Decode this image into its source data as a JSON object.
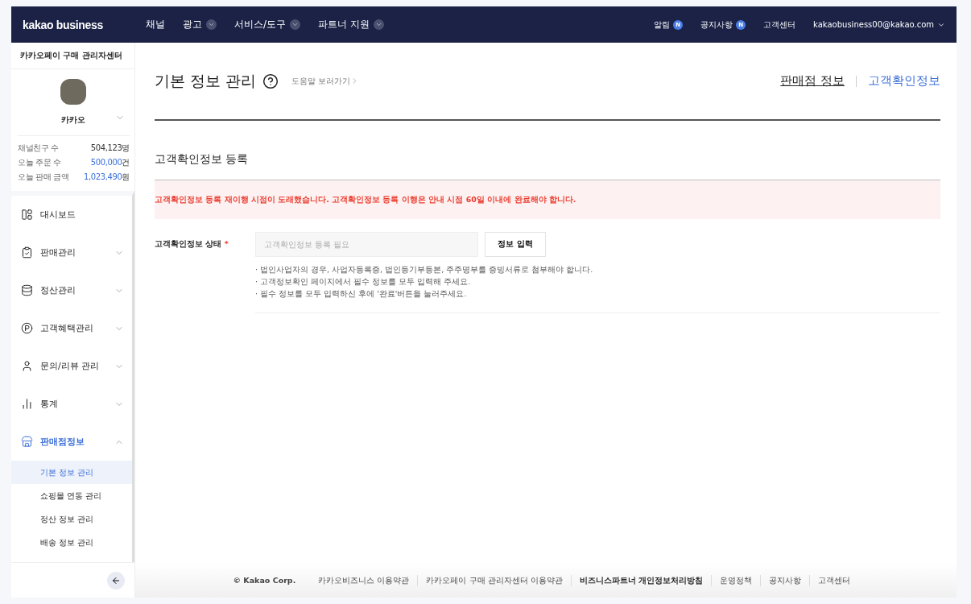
{
  "header": {
    "logo": "kakao business",
    "nav": [
      {
        "label": "채널",
        "dropdown": false
      },
      {
        "label": "광고",
        "dropdown": true
      },
      {
        "label": "서비스/도구",
        "dropdown": true
      },
      {
        "label": "파트너 지원",
        "dropdown": true
      }
    ],
    "links": [
      {
        "label": "알림",
        "badge": "N"
      },
      {
        "label": "공지사항",
        "badge": "N"
      },
      {
        "label": "고객센터"
      }
    ],
    "account": "kakaobusiness00@kakao.com"
  },
  "sidebar": {
    "title": "카카오페이 구매 관리자센터",
    "profile_name": "카카오",
    "stats": [
      {
        "label": "채널친구 수",
        "value": "504,123",
        "unit": "명",
        "highlight": false
      },
      {
        "label": "오늘 주문 수",
        "value": "500,000",
        "unit": "건",
        "highlight": true
      },
      {
        "label": "오늘 판매 금액",
        "value": "1,023,490",
        "unit": "원",
        "highlight": true
      }
    ],
    "menu": [
      {
        "label": "대시보드",
        "kind": "link",
        "selected": false
      },
      {
        "label": "판매관리",
        "kind": "group",
        "expanded": false,
        "selected": false
      },
      {
        "label": "정산관리",
        "kind": "group",
        "expanded": false,
        "selected": false
      },
      {
        "label": "고객혜택관리",
        "kind": "group",
        "expanded": false,
        "selected": false
      },
      {
        "label": "문의/리뷰 관리",
        "kind": "group",
        "expanded": false,
        "selected": false
      },
      {
        "label": "통계",
        "kind": "group",
        "expanded": false,
        "selected": false
      },
      {
        "label": "판매점정보",
        "kind": "group",
        "expanded": true,
        "selected": true,
        "children": [
          {
            "label": "기본 정보 관리",
            "selected": true
          },
          {
            "label": "쇼핑몰 연동 관리",
            "selected": false
          },
          {
            "label": "정산 정보 관리",
            "selected": false
          },
          {
            "label": "배송 정보 관리",
            "selected": false
          }
        ]
      }
    ]
  },
  "page": {
    "title": "기본 정보 관리",
    "help_link": "도움말 보러가기",
    "tabs": [
      {
        "label": "판매점 정보",
        "selected": false
      },
      {
        "label": "고객확인정보",
        "selected": true
      }
    ],
    "section_title": "고객확인정보 등록",
    "alert": "고객확인정보 등록 재이행 시점이 도래했습니다. 고객확인정보 등록 이행은 안내 시점 60일 이내에 완료해야 합니다.",
    "field": {
      "label": "고객확인정보 상태",
      "required_mark": "*",
      "placeholder": "고객확인정보 등록 필요",
      "button": "정보 입력"
    },
    "notes": [
      "법인사업자의 경우, 사업자등록증, 법인등기부등본, 주주명부를 증빙서류로 첨부해야 합니다.",
      "고객정보확인 페이지에서 필수 정보를 모두 입력해 주세요.",
      "필수 정보를 모두 입력하신 후에 '완료'버튼을 눌러주세요."
    ],
    "bullet": "·"
  },
  "footer": {
    "copyright": "© Kakao Corp.",
    "links": [
      {
        "label": "카카오비즈니스 이용약관",
        "emphasized": false
      },
      {
        "label": "카카오페이 구매 관리자센터 이용약관",
        "emphasized": false
      },
      {
        "label": "비즈니스파트너 개인정보처리방침",
        "emphasized": true
      },
      {
        "label": "운영정책",
        "emphasized": false
      },
      {
        "label": "공지사항",
        "emphasized": false
      },
      {
        "label": "고객센터",
        "emphasized": false
      }
    ]
  }
}
